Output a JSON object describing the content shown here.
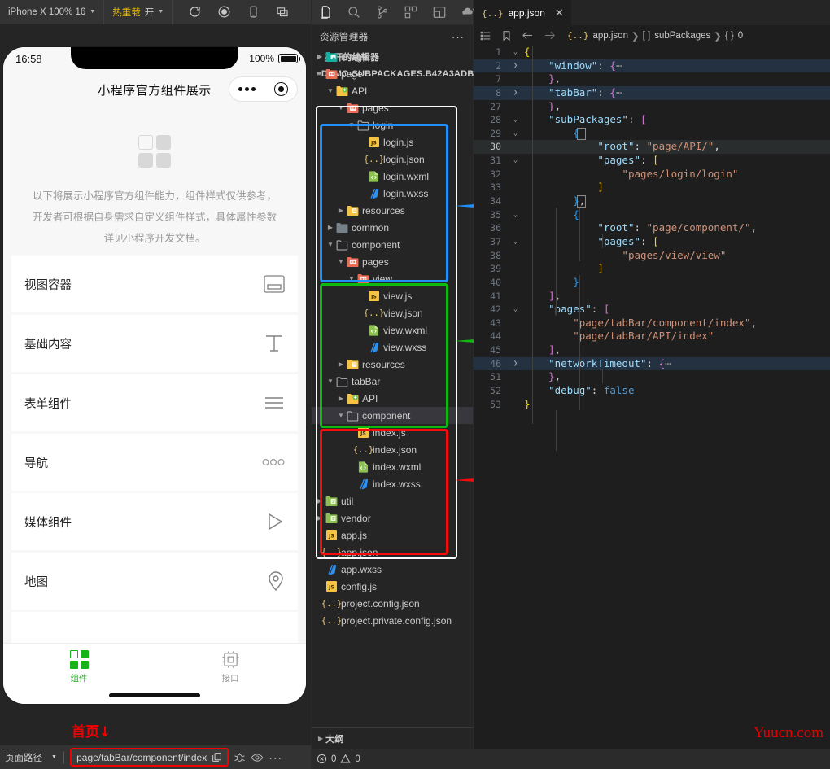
{
  "simulator": {
    "toolbar": {
      "device": "iPhone X 100% 16",
      "hotreload_label": "热重载",
      "hotreload_value": "开",
      "icons": [
        "refresh-icon",
        "record-icon",
        "phone-icon",
        "windows-icon"
      ]
    },
    "phone": {
      "status_time": "16:58",
      "battery_percent": "100%",
      "nav_title": "小程序官方组件展示",
      "hero_desc": "以下将展示小程序官方组件能力，组件样式仅供参考，开发者可根据自身需求自定义组件样式，具体属性参数详见小程序开发文档。",
      "list": [
        {
          "label": "视图容器",
          "icon": "view-container-icon"
        },
        {
          "label": "基础内容",
          "icon": "text-icon"
        },
        {
          "label": "表单组件",
          "icon": "form-lines-icon"
        },
        {
          "label": "导航",
          "icon": "three-circles-icon"
        },
        {
          "label": "媒体组件",
          "icon": "play-triangle-icon"
        },
        {
          "label": "地图",
          "icon": "map-pin-icon"
        }
      ],
      "tabbar": [
        {
          "label": "组件",
          "icon": "grid-icon",
          "active": true
        },
        {
          "label": "接口",
          "icon": "chip-icon",
          "active": false
        }
      ]
    },
    "annotation": "首页↓",
    "statusbar": {
      "page_path_label": "页面路径",
      "page_path_value": "page/tabBar/component/index",
      "icons": [
        "copy-icon",
        "bug-icon",
        "eye-icon",
        "more-icon"
      ]
    }
  },
  "explorer": {
    "activity_icons": [
      "files-icon",
      "search-icon",
      "source-control-icon",
      "extensions-icon",
      "debug-icon",
      "cloud-icon"
    ],
    "title": "资源管理器",
    "more": "···",
    "open_editors": "打开的编辑器",
    "project_name": "DEMO-SUBPACKAGES.B42A3ADB",
    "outline": "大纲",
    "tree": [
      {
        "label": "image",
        "depth": 1,
        "type": "folder-teal",
        "twisty": "collapsed"
      },
      {
        "label": "page",
        "depth": 1,
        "type": "folder-red",
        "twisty": "expanded"
      },
      {
        "label": "API",
        "depth": 2,
        "type": "folder-yellow-plus",
        "twisty": "expanded"
      },
      {
        "label": "pages",
        "depth": 3,
        "type": "folder-red",
        "twisty": "expanded"
      },
      {
        "label": "login",
        "depth": 4,
        "type": "folder-grey",
        "twisty": "expanded"
      },
      {
        "label": "login.js",
        "depth": 5,
        "type": "js",
        "twisty": "none"
      },
      {
        "label": "login.json",
        "depth": 5,
        "type": "json",
        "twisty": "none"
      },
      {
        "label": "login.wxml",
        "depth": 5,
        "type": "wxml",
        "twisty": "none"
      },
      {
        "label": "login.wxss",
        "depth": 5,
        "type": "wxss",
        "twisty": "none"
      },
      {
        "label": "resources",
        "depth": 3,
        "type": "folder-yellow",
        "twisty": "collapsed"
      },
      {
        "label": "common",
        "depth": 2,
        "type": "folder-grey-solid",
        "twisty": "collapsed"
      },
      {
        "label": "component",
        "depth": 2,
        "type": "folder-grey",
        "twisty": "expanded"
      },
      {
        "label": "pages",
        "depth": 3,
        "type": "folder-red",
        "twisty": "expanded"
      },
      {
        "label": "view",
        "depth": 4,
        "type": "folder-red",
        "twisty": "expanded"
      },
      {
        "label": "view.js",
        "depth": 5,
        "type": "js",
        "twisty": "none"
      },
      {
        "label": "view.json",
        "depth": 5,
        "type": "json",
        "twisty": "none"
      },
      {
        "label": "view.wxml",
        "depth": 5,
        "type": "wxml",
        "twisty": "none"
      },
      {
        "label": "view.wxss",
        "depth": 5,
        "type": "wxss",
        "twisty": "none"
      },
      {
        "label": "resources",
        "depth": 3,
        "type": "folder-yellow",
        "twisty": "collapsed"
      },
      {
        "label": "tabBar",
        "depth": 2,
        "type": "folder-grey",
        "twisty": "expanded"
      },
      {
        "label": "API",
        "depth": 3,
        "type": "folder-yellow-plus",
        "twisty": "collapsed"
      },
      {
        "label": "component",
        "depth": 3,
        "type": "folder-grey",
        "twisty": "expanded",
        "selected": true
      },
      {
        "label": "index.js",
        "depth": 4,
        "type": "js",
        "twisty": "none"
      },
      {
        "label": "index.json",
        "depth": 4,
        "type": "json",
        "twisty": "none"
      },
      {
        "label": "index.wxml",
        "depth": 4,
        "type": "wxml",
        "twisty": "none"
      },
      {
        "label": "index.wxss",
        "depth": 4,
        "type": "wxss",
        "twisty": "none"
      },
      {
        "label": "util",
        "depth": 1,
        "type": "folder-green",
        "twisty": "collapsed"
      },
      {
        "label": "vendor",
        "depth": 1,
        "type": "folder-green",
        "twisty": "collapsed"
      },
      {
        "label": "app.js",
        "depth": 1,
        "type": "js",
        "twisty": "none"
      },
      {
        "label": "app.json",
        "depth": 1,
        "type": "json",
        "twisty": "none"
      },
      {
        "label": "app.wxss",
        "depth": 1,
        "type": "wxss",
        "twisty": "none"
      },
      {
        "label": "config.js",
        "depth": 1,
        "type": "js",
        "twisty": "none"
      },
      {
        "label": "project.config.json",
        "depth": 1,
        "type": "json",
        "twisty": "none"
      },
      {
        "label": "project.private.config.json",
        "depth": 1,
        "type": "json",
        "twisty": "none"
      }
    ],
    "highlights": [
      {
        "name": "blue-box",
        "color": "#1e90ff"
      },
      {
        "name": "green-box",
        "color": "#0fba0f"
      },
      {
        "name": "red-box",
        "color": "#fa0a0a"
      }
    ]
  },
  "editor": {
    "tab": {
      "label": "app.json",
      "icon": "json-icon",
      "close": "✕"
    },
    "breadcrumb": {
      "icons": [
        "outline-list-icon",
        "bookmark-icon",
        "back-arrow-icon",
        "forward-arrow-icon"
      ],
      "parts": [
        "app.json",
        "subPackages",
        "0"
      ],
      "part_icons": [
        "{..}",
        "[ ]",
        "{ }"
      ]
    },
    "lines": [
      {
        "n": "1",
        "fold": "expanded",
        "indent": 0,
        "tokens": [
          [
            "br1",
            "{"
          ]
        ]
      },
      {
        "n": "2",
        "fold": "collapsed",
        "indent": 1,
        "folded": true,
        "tokens": [
          [
            "k",
            "\"window\""
          ],
          [
            "p",
            ": "
          ],
          [
            "br2",
            "{"
          ],
          [
            "el",
            "⋯"
          ]
        ]
      },
      {
        "n": "7",
        "fold": "",
        "indent": 1,
        "tokens": [
          [
            "br2",
            "}"
          ],
          [
            "p",
            ","
          ]
        ]
      },
      {
        "n": "8",
        "fold": "collapsed",
        "indent": 1,
        "folded": true,
        "tokens": [
          [
            "k",
            "\"tabBar\""
          ],
          [
            "p",
            ": "
          ],
          [
            "br2",
            "{"
          ],
          [
            "el",
            "⋯"
          ]
        ]
      },
      {
        "n": "27",
        "fold": "",
        "indent": 1,
        "tokens": [
          [
            "br2",
            "}"
          ],
          [
            "p",
            ","
          ]
        ]
      },
      {
        "n": "28",
        "fold": "expanded",
        "indent": 1,
        "tokens": [
          [
            "k",
            "\"subPackages\""
          ],
          [
            "p",
            ": "
          ],
          [
            "br2",
            "["
          ]
        ]
      },
      {
        "n": "29",
        "fold": "expanded",
        "indent": 2,
        "tokens": [
          [
            "br3",
            "{"
          ]
        ],
        "boxed": true
      },
      {
        "n": "30",
        "fold": "",
        "indent": 3,
        "current": true,
        "tokens": [
          [
            "k",
            "\"root\""
          ],
          [
            "p",
            ": "
          ],
          [
            "s",
            "\"page/API/\""
          ],
          [
            "p",
            ","
          ]
        ]
      },
      {
        "n": "31",
        "fold": "expanded",
        "indent": 3,
        "tokens": [
          [
            "k",
            "\"pages\""
          ],
          [
            "p",
            ": "
          ],
          [
            "br1",
            "["
          ]
        ]
      },
      {
        "n": "32",
        "fold": "",
        "indent": 4,
        "tokens": [
          [
            "s",
            "\"pages/login/login\""
          ]
        ]
      },
      {
        "n": "33",
        "fold": "",
        "indent": 3,
        "tokens": [
          [
            "br1",
            "]"
          ]
        ]
      },
      {
        "n": "34",
        "fold": "",
        "indent": 2,
        "tokens": [
          [
            "br3",
            "}"
          ],
          [
            "p",
            ","
          ]
        ],
        "boxed": true
      },
      {
        "n": "35",
        "fold": "expanded",
        "indent": 2,
        "tokens": [
          [
            "br3",
            "{"
          ]
        ]
      },
      {
        "n": "36",
        "fold": "",
        "indent": 3,
        "tokens": [
          [
            "k",
            "\"root\""
          ],
          [
            "p",
            ": "
          ],
          [
            "s",
            "\"page/component/\""
          ],
          [
            "p",
            ","
          ]
        ]
      },
      {
        "n": "37",
        "fold": "expanded",
        "indent": 3,
        "tokens": [
          [
            "k",
            "\"pages\""
          ],
          [
            "p",
            ": "
          ],
          [
            "br1",
            "["
          ]
        ]
      },
      {
        "n": "38",
        "fold": "",
        "indent": 4,
        "tokens": [
          [
            "s",
            "\"pages/view/view\""
          ]
        ]
      },
      {
        "n": "39",
        "fold": "",
        "indent": 3,
        "tokens": [
          [
            "br1",
            "]"
          ]
        ]
      },
      {
        "n": "40",
        "fold": "",
        "indent": 2,
        "tokens": [
          [
            "br3",
            "}"
          ]
        ]
      },
      {
        "n": "41",
        "fold": "",
        "indent": 1,
        "tokens": [
          [
            "br2",
            "]"
          ],
          [
            "p",
            ","
          ]
        ]
      },
      {
        "n": "42",
        "fold": "expanded",
        "indent": 1,
        "tokens": [
          [
            "k",
            "\"pages\""
          ],
          [
            "p",
            ": "
          ],
          [
            "br2",
            "["
          ]
        ]
      },
      {
        "n": "43",
        "fold": "",
        "indent": 2,
        "tokens": [
          [
            "s",
            "\"page/tabBar/component/index\""
          ],
          [
            "p",
            ","
          ]
        ]
      },
      {
        "n": "44",
        "fold": "",
        "indent": 2,
        "tokens": [
          [
            "s",
            "\"page/tabBar/API/index\""
          ]
        ]
      },
      {
        "n": "45",
        "fold": "",
        "indent": 1,
        "tokens": [
          [
            "br2",
            "]"
          ],
          [
            "p",
            ","
          ]
        ]
      },
      {
        "n": "46",
        "fold": "collapsed",
        "indent": 1,
        "folded": true,
        "tokens": [
          [
            "k",
            "\"networkTimeout\""
          ],
          [
            "p",
            ": "
          ],
          [
            "br2",
            "{"
          ],
          [
            "el",
            "⋯"
          ]
        ]
      },
      {
        "n": "51",
        "fold": "",
        "indent": 1,
        "tokens": [
          [
            "br2",
            "}"
          ],
          [
            "p",
            ","
          ]
        ]
      },
      {
        "n": "52",
        "fold": "",
        "indent": 1,
        "tokens": [
          [
            "k",
            "\"debug\""
          ],
          [
            "p",
            ": "
          ],
          [
            "kw",
            "false"
          ]
        ]
      },
      {
        "n": "53",
        "fold": "",
        "indent": 0,
        "tokens": [
          [
            "br1",
            "}"
          ]
        ]
      }
    ],
    "watermark": "Yuucn.com"
  },
  "bottom_status": {
    "errors": "0",
    "warnings": "0"
  }
}
